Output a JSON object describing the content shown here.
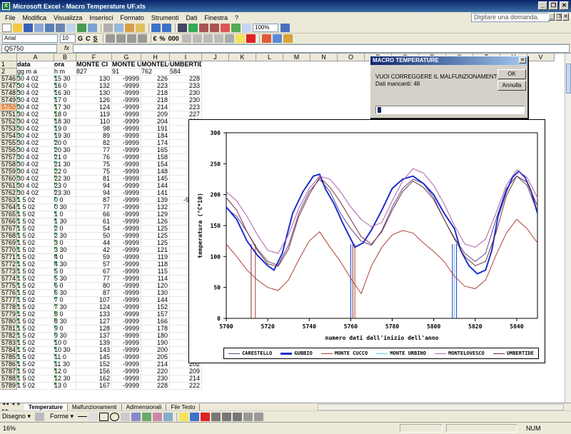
{
  "window": {
    "title": "Microsoft Excel - Macro Temperature UF.xls",
    "app_icon": "excel-icon"
  },
  "menubar": {
    "items": [
      "File",
      "Modifica",
      "Visualizza",
      "Inserisci",
      "Formato",
      "Strumenti",
      "Dati",
      "Finestra",
      "?"
    ],
    "ask_placeholder": "Digitare una domanda."
  },
  "toolbar": {
    "zoom": "100%",
    "font_name": "Arial",
    "font_size": "10",
    "bold": "G",
    "italic": "C",
    "underline": "S",
    "currency": "€",
    "percent": "%",
    "thousands": "000"
  },
  "formulabar": {
    "namebox": "Q5750",
    "fx": "fx",
    "content": ""
  },
  "grid": {
    "columns": [
      "A",
      "B",
      "F",
      "G",
      "H",
      "I",
      "J",
      "K",
      "L",
      "M",
      "N",
      "O",
      "P",
      "Q",
      "R",
      "S",
      "T",
      "U",
      "V"
    ],
    "row1_label": "1",
    "row2_label": "2",
    "header1": {
      "a": "data",
      "b": "ora",
      "f": "MONTE CI",
      "g": "MONTE UI",
      "h": "MONTELO",
      "i": "UMBERTIDE"
    },
    "header2": {
      "a": "gg  m  a",
      "b": "h  m",
      "f": "827",
      "g": "91",
      "h": "762",
      "i": "584"
    },
    "rows": [
      {
        "n": "5746",
        "a": "30  4 02",
        "b": "15 30",
        "f": "130",
        "g": "-9999",
        "h": "226",
        "i": "228"
      },
      {
        "n": "5747",
        "a": "30  4 02",
        "b": "16  0",
        "f": "132",
        "g": "-9999",
        "h": "223",
        "i": "233"
      },
      {
        "n": "5748",
        "a": "30  4 02",
        "b": "16 30",
        "f": "130",
        "g": "-9999",
        "h": "218",
        "i": "230"
      },
      {
        "n": "5749",
        "a": "30  4 02",
        "b": "17  0",
        "f": "126",
        "g": "-9999",
        "h": "218",
        "i": "230"
      },
      {
        "n": "5750",
        "a": "30  4 02",
        "b": "17 30",
        "f": "124",
        "g": "-9999",
        "h": "214",
        "i": "223"
      },
      {
        "n": "5751",
        "a": "30  4 02",
        "b": "18  0",
        "f": "119",
        "g": "-9999",
        "h": "209",
        "i": "227"
      },
      {
        "n": "5752",
        "a": "30  4 02",
        "b": "18 30",
        "f": "110",
        "g": "-9999",
        "h": "204",
        "i": "221"
      },
      {
        "n": "5753",
        "a": "30  4 02",
        "b": "19  0",
        "f": "98",
        "g": "-9999",
        "h": "191",
        "i": "209"
      },
      {
        "n": "5754",
        "a": "30  4 02",
        "b": "19 30",
        "f": "89",
        "g": "-9999",
        "h": "184",
        "i": "195"
      },
      {
        "n": "5755",
        "a": "30  4 02",
        "b": "20  0",
        "f": "82",
        "g": "-9999",
        "h": "174",
        "i": "177"
      },
      {
        "n": "5756",
        "a": "30  4 02",
        "b": "20 30",
        "f": "77",
        "g": "-9999",
        "h": "165",
        "i": "166"
      },
      {
        "n": "5757",
        "a": "30  4 02",
        "b": "21  0",
        "f": "76",
        "g": "-9999",
        "h": "158",
        "i": "169"
      },
      {
        "n": "5758",
        "a": "30  4 02",
        "b": "21 30",
        "f": "75",
        "g": "-9999",
        "h": "154",
        "i": "162"
      },
      {
        "n": "5759",
        "a": "30  4 02",
        "b": "22  0",
        "f": "75",
        "g": "-9999",
        "h": "148",
        "i": "158"
      },
      {
        "n": "5760",
        "a": "30  4 02",
        "b": "22 30",
        "f": "81",
        "g": "-9999",
        "h": "145",
        "i": "153"
      },
      {
        "n": "5761",
        "a": "30  4 02",
        "b": "23  0",
        "f": "94",
        "g": "-9999",
        "h": "144",
        "i": "152"
      },
      {
        "n": "5762",
        "a": "30  4 02",
        "b": "23 30",
        "f": "94",
        "g": "-9999",
        "h": "141",
        "i": "149"
      },
      {
        "n": "5763",
        "a": "1  5 02",
        "b": "0  0",
        "f": "87",
        "g": "-9999",
        "h": "139",
        "i": "-9999"
      },
      {
        "n": "5764",
        "a": "1  5 02",
        "b": "0 30",
        "f": "77",
        "g": "-9999",
        "h": "132",
        "i": "142"
      },
      {
        "n": "5765",
        "a": "1  5 02",
        "b": "1  0",
        "f": "66",
        "g": "-9999",
        "h": "129",
        "i": "128"
      },
      {
        "n": "5766",
        "a": "1  5 02",
        "b": "1 30",
        "f": "61",
        "g": "-9999",
        "h": "126",
        "i": "120"
      },
      {
        "n": "5767",
        "a": "1  5 02",
        "b": "2  0",
        "f": "54",
        "g": "-9999",
        "h": "125",
        "i": "114"
      },
      {
        "n": "5768",
        "a": "1  5 02",
        "b": "2 30",
        "f": "50",
        "g": "-9999",
        "h": "125",
        "i": "108"
      },
      {
        "n": "5769",
        "a": "1  5 02",
        "b": "3  0",
        "f": "44",
        "g": "-9999",
        "h": "125",
        "i": "100"
      },
      {
        "n": "5770",
        "a": "1  5 02",
        "b": "3 30",
        "f": "42",
        "g": "-9999",
        "h": "121",
        "i": "94"
      },
      {
        "n": "5771",
        "a": "1  5 02",
        "b": "4  0",
        "f": "59",
        "g": "-9999",
        "h": "119",
        "i": "91"
      },
      {
        "n": "5772",
        "a": "1  5 02",
        "b": "4 30",
        "f": "57",
        "g": "-9999",
        "h": "118",
        "i": "87"
      },
      {
        "n": "5773",
        "a": "1  5 02",
        "b": "5  0",
        "f": "67",
        "g": "-9999",
        "h": "115",
        "i": "83"
      },
      {
        "n": "5774",
        "a": "1  5 02",
        "b": "5 30",
        "f": "77",
        "g": "-9999",
        "h": "114",
        "i": "76"
      },
      {
        "n": "5775",
        "a": "1  5 02",
        "b": "6  0",
        "f": "80",
        "g": "-9999",
        "h": "120",
        "i": "79"
      },
      {
        "n": "5776",
        "a": "1  5 02",
        "b": "6 30",
        "f": "87",
        "g": "-9999",
        "h": "130",
        "i": "85"
      },
      {
        "n": "5777",
        "a": "1  5 02",
        "b": "7  0",
        "f": "107",
        "g": "-9999",
        "h": "144",
        "i": "92"
      },
      {
        "n": "5778",
        "a": "1  5 02",
        "b": "7 30",
        "f": "124",
        "g": "-9999",
        "h": "152",
        "i": "105"
      },
      {
        "n": "5779",
        "a": "1  5 02",
        "b": "8  0",
        "f": "133",
        "g": "-9999",
        "h": "157",
        "i": "116"
      },
      {
        "n": "5780",
        "a": "1  5 02",
        "b": "8 30",
        "f": "127",
        "g": "-9999",
        "h": "166",
        "i": "136"
      },
      {
        "n": "5781",
        "a": "1  5 02",
        "b": "9  0",
        "f": "128",
        "g": "-9999",
        "h": "178",
        "i": "152"
      },
      {
        "n": "5782",
        "a": "1  5 02",
        "b": "9 30",
        "f": "137",
        "g": "-9999",
        "h": "180",
        "i": "162"
      },
      {
        "n": "5783",
        "a": "1  5 02",
        "b": "10  0",
        "f": "139",
        "g": "-9999",
        "h": "190",
        "i": "173"
      },
      {
        "n": "5784",
        "a": "1  5 02",
        "b": "10 30",
        "f": "143",
        "g": "-9999",
        "h": "200",
        "i": "183"
      },
      {
        "n": "5785",
        "a": "1  5 02",
        "b": "11  0",
        "f": "145",
        "g": "-9999",
        "h": "205",
        "i": "195"
      },
      {
        "n": "5786",
        "a": "1  5 02",
        "b": "11 30",
        "f": "152",
        "g": "-9999",
        "h": "214",
        "i": "202"
      },
      {
        "n": "5787",
        "a": "1  5 02",
        "b": "12  0",
        "f": "156",
        "g": "-9999",
        "h": "220",
        "i": "209"
      },
      {
        "n": "5788",
        "a": "1  5 02",
        "b": "12 30",
        "f": "162",
        "g": "-9999",
        "h": "230",
        "i": "214"
      },
      {
        "n": "5789",
        "a": "1  5 02",
        "b": "13  0",
        "f": "167",
        "g": "-9999",
        "h": "228",
        "i": "222"
      }
    ],
    "selected_row": "5750"
  },
  "sheet_tabs": [
    "Temperature",
    "Malfunzionamenti",
    "Adimensionali",
    "File Testo"
  ],
  "drawbar": {
    "disegno": "Disegno ▾",
    "forme": "Forme ▾"
  },
  "statusbar": {
    "zoom_text": "16%",
    "num": "NUM"
  },
  "dialog": {
    "title": "MACRO TEMPERATURE",
    "message_line1": "VUOI CORREGGERE IL MALFUNZIONAMENTO ?",
    "message_line2": "Dati mancanti: 48",
    "ok_label": "OK",
    "cancel_label": "Annulla",
    "input_value": ""
  },
  "chart_data": {
    "type": "line",
    "xlabel": "numero dati dall'inizio dell'anno",
    "ylabel": "temperatura (°C*10)",
    "xlim": [
      5700,
      5850
    ],
    "ylim": [
      0,
      300
    ],
    "xticks": [
      5700,
      5720,
      5740,
      5760,
      5780,
      5800,
      5820,
      5840
    ],
    "yticks": [
      0,
      50,
      100,
      150,
      200,
      250,
      300
    ],
    "grid": false,
    "legend_position": "bottom",
    "series": [
      {
        "name": "CARESTELLO",
        "color": "#5a4a8c",
        "width": 1,
        "x": [
          5700,
          5705,
          5710,
          5715,
          5720,
          5725,
          5730,
          5735,
          5740,
          5745,
          5750,
          5755,
          5760,
          5765,
          5770,
          5775,
          5780,
          5785,
          5790,
          5795,
          5800,
          5805,
          5810,
          5815,
          5820,
          5825,
          5830,
          5835,
          5840,
          5845,
          5850
        ],
        "y": [
          178,
          165,
          140,
          112,
          92,
          86,
          118,
          170,
          205,
          225,
          205,
          170,
          145,
          125,
          118,
          142,
          180,
          210,
          225,
          218,
          195,
          160,
          130,
          105,
          92,
          105,
          160,
          210,
          230,
          215,
          172
        ]
      },
      {
        "name": "GUBBIO",
        "color": "#1a2fcc",
        "width": 2,
        "x": [
          5700,
          5705,
          5710,
          5715,
          5720,
          5723,
          5727,
          5732,
          5737,
          5742,
          5745,
          5748,
          5752,
          5756,
          5759,
          5762,
          5766,
          5770,
          5775,
          5780,
          5785,
          5790,
          5795,
          5800,
          5805,
          5810,
          5813,
          5817,
          5821,
          5825,
          5828,
          5831,
          5835,
          5838,
          5841,
          5844,
          5847,
          5850
        ],
        "y": [
          180,
          160,
          125,
          102,
          85,
          78,
          105,
          170,
          205,
          230,
          233,
          208,
          185,
          155,
          135,
          115,
          122,
          143,
          175,
          210,
          225,
          230,
          218,
          200,
          170,
          145,
          110,
          85,
          72,
          78,
          110,
          165,
          205,
          228,
          238,
          228,
          205,
          170
        ]
      },
      {
        "name": "MONTE CUCCO",
        "color": "#b04038",
        "width": 1,
        "x": [
          5700,
          5705,
          5710,
          5715,
          5720,
          5725,
          5730,
          5735,
          5740,
          5745,
          5750,
          5755,
          5760,
          5765,
          5770,
          5775,
          5780,
          5785,
          5790,
          5795,
          5800,
          5805,
          5810,
          5815,
          5820,
          5825,
          5830,
          5835,
          5840,
          5845,
          5850
        ],
        "y": [
          120,
          100,
          78,
          62,
          50,
          45,
          62,
          95,
          125,
          140,
          115,
          92,
          65,
          40,
          85,
          115,
          135,
          142,
          138,
          122,
          108,
          92,
          68,
          52,
          48,
          62,
          102,
          138,
          160,
          145,
          122
        ]
      },
      {
        "name": "MONTE URBINO",
        "color": "#4fd3e8",
        "width": 1,
        "x": [
          5700,
          5850
        ],
        "y": [
          null,
          null
        ]
      },
      {
        "name": "MONTELOVESCO",
        "color": "#b060a8",
        "width": 1,
        "x": [
          5700,
          5705,
          5710,
          5715,
          5720,
          5725,
          5730,
          5735,
          5740,
          5745,
          5750,
          5755,
          5760,
          5765,
          5770,
          5775,
          5780,
          5785,
          5790,
          5795,
          5800,
          5805,
          5810,
          5815,
          5820,
          5825,
          5830,
          5835,
          5840,
          5845,
          5850
        ],
        "y": [
          205,
          190,
          165,
          135,
          110,
          105,
          135,
          178,
          210,
          230,
          225,
          205,
          180,
          160,
          148,
          155,
          190,
          222,
          242,
          235,
          215,
          185,
          150,
          120,
          115,
          128,
          170,
          215,
          240,
          228,
          195
        ]
      },
      {
        "name": "UMBERTIDE",
        "color": "#7a3038",
        "width": 1,
        "x": [
          5700,
          5705,
          5710,
          5715,
          5720,
          5725,
          5730,
          5735,
          5740,
          5745,
          5750,
          5755,
          5760,
          5765,
          5770,
          5775,
          5780,
          5785,
          5790,
          5795,
          5800,
          5805,
          5810,
          5815,
          5820,
          5825,
          5830,
          5835,
          5840,
          5845,
          5850
        ],
        "y": [
          195,
          175,
          140,
          110,
          88,
          84,
          112,
          165,
          200,
          228,
          212,
          188,
          160,
          132,
          120,
          140,
          175,
          205,
          222,
          212,
          192,
          160,
          128,
          100,
          85,
          92,
          138,
          198,
          230,
          220,
          182
        ]
      }
    ],
    "vertical_markers": [
      {
        "x": 5712,
        "color": "#7a3038"
      },
      {
        "x": 5714,
        "color": "#b04038"
      },
      {
        "x": 5760,
        "color": "#1a2fcc"
      },
      {
        "x": 5761,
        "color": "#7a3038"
      },
      {
        "x": 5762,
        "color": "#b04038"
      },
      {
        "x": 5809,
        "color": "#1a2fcc"
      },
      {
        "x": 5810,
        "color": "#4fd3e8"
      },
      {
        "x": 5811,
        "color": "#1a2fcc"
      }
    ]
  }
}
